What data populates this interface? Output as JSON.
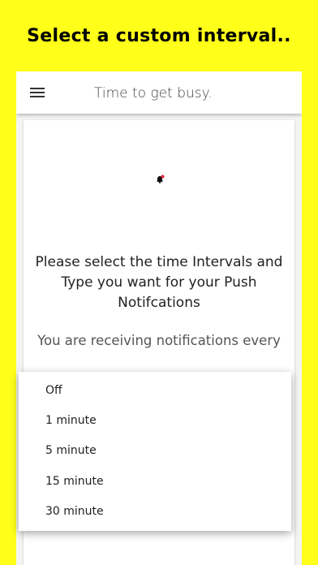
{
  "banner": {
    "text": "Select a custom interval.."
  },
  "app_bar": {
    "title": "Time to get busy.",
    "menu_icon": "hamburger-menu-icon"
  },
  "card": {
    "icon": "bell-icon",
    "prompt": "Please select the time Intervals and Type you want for your Push Notifcations",
    "receiving_text": "You are receiving notifications every"
  },
  "dropdown": {
    "options": [
      "Off",
      "1 minute",
      "5 minute",
      "15 minute",
      "30 minute"
    ]
  },
  "colors": {
    "background": "#ffff1a",
    "bell": "#111111",
    "bell_dot": "#e0263a"
  }
}
